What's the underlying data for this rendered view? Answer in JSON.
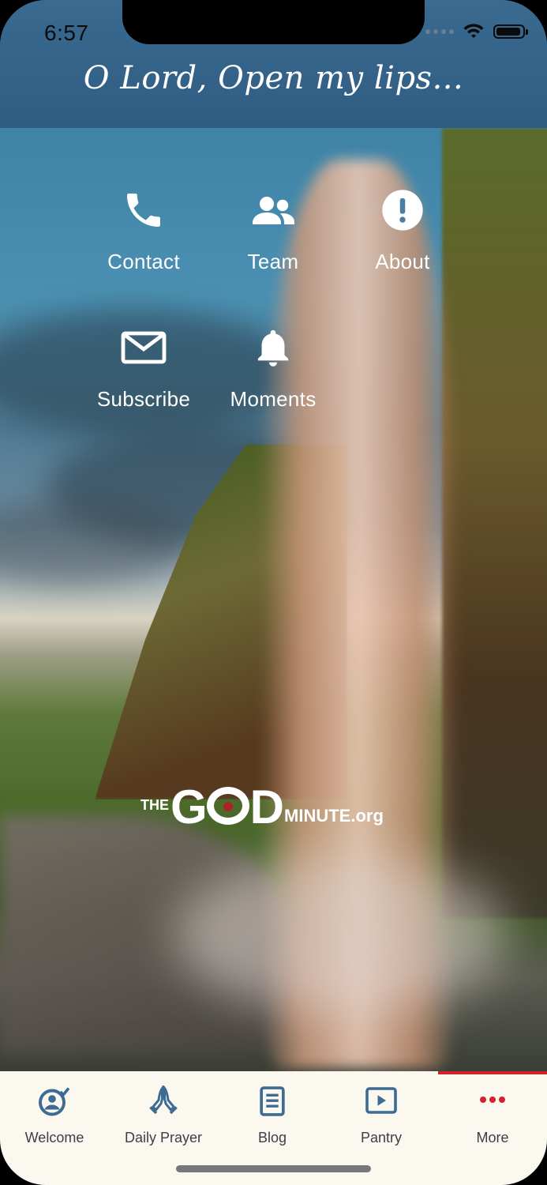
{
  "status_bar": {
    "time": "6:57",
    "icons": [
      "signal-icon",
      "wifi-icon",
      "battery-icon"
    ]
  },
  "header": {
    "title": "O Lord, Open my lips..."
  },
  "menu": {
    "items": [
      {
        "label": "Contact",
        "icon": "phone-icon"
      },
      {
        "label": "Team",
        "icon": "people-icon"
      },
      {
        "label": "About",
        "icon": "info-alert-icon"
      },
      {
        "label": "Subscribe",
        "icon": "mail-icon"
      },
      {
        "label": "Moments",
        "icon": "bell-icon"
      }
    ]
  },
  "logo": {
    "the": "THE",
    "god_g": "G",
    "god_d": "D",
    "minute": "MINUTE.org"
  },
  "tabbar": {
    "accent_color": "#d2222a",
    "icon_color": "#3e6b93",
    "active_tab": "More",
    "tabs": [
      {
        "label": "Welcome",
        "icon": "welcome-check-icon"
      },
      {
        "label": "Daily Prayer",
        "icon": "praying-hands-icon"
      },
      {
        "label": "Blog",
        "icon": "document-icon"
      },
      {
        "label": "Pantry",
        "icon": "play-video-icon"
      },
      {
        "label": "More",
        "icon": "more-dots-icon"
      }
    ]
  }
}
